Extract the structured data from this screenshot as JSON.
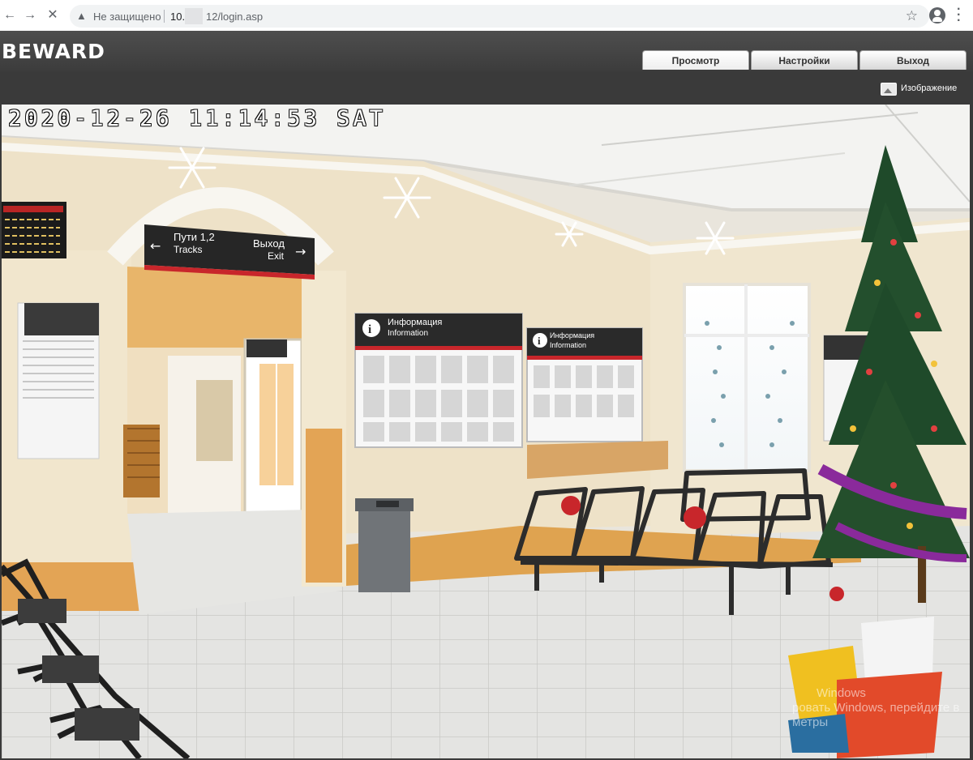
{
  "browser": {
    "security_label": "Не защищено",
    "url_part1": "10.",
    "url_part2": "12/login.asp",
    "icons": [
      "back-icon",
      "forward-icon",
      "stop-icon",
      "warning-icon",
      "star-icon",
      "profile-icon",
      "menu-icon"
    ]
  },
  "app": {
    "brand": "BEWARD",
    "tabs": [
      {
        "label": "Просмотр",
        "active": true
      },
      {
        "label": "Настройки",
        "active": false
      },
      {
        "label": "Выход",
        "active": false
      }
    ],
    "image_label": "Изображение"
  },
  "video": {
    "timestamp": "2020-12-26 11:14:53 SAT",
    "signs": {
      "direction_left": "Пути 1,2",
      "direction_left_en": "Tracks",
      "direction_right": "Выход",
      "direction_right_en": "Exit",
      "info_ru": "Информация",
      "info_en": "Information"
    },
    "watermark_line1": "Windows",
    "watermark_line2": "ровать Windows, перейдите в",
    "watermark_line3": "метры"
  },
  "colors": {
    "header": "#444444",
    "tab_bg": "#e8e8e8",
    "wall": "#efe5cf",
    "orange": "#e0a04a"
  }
}
